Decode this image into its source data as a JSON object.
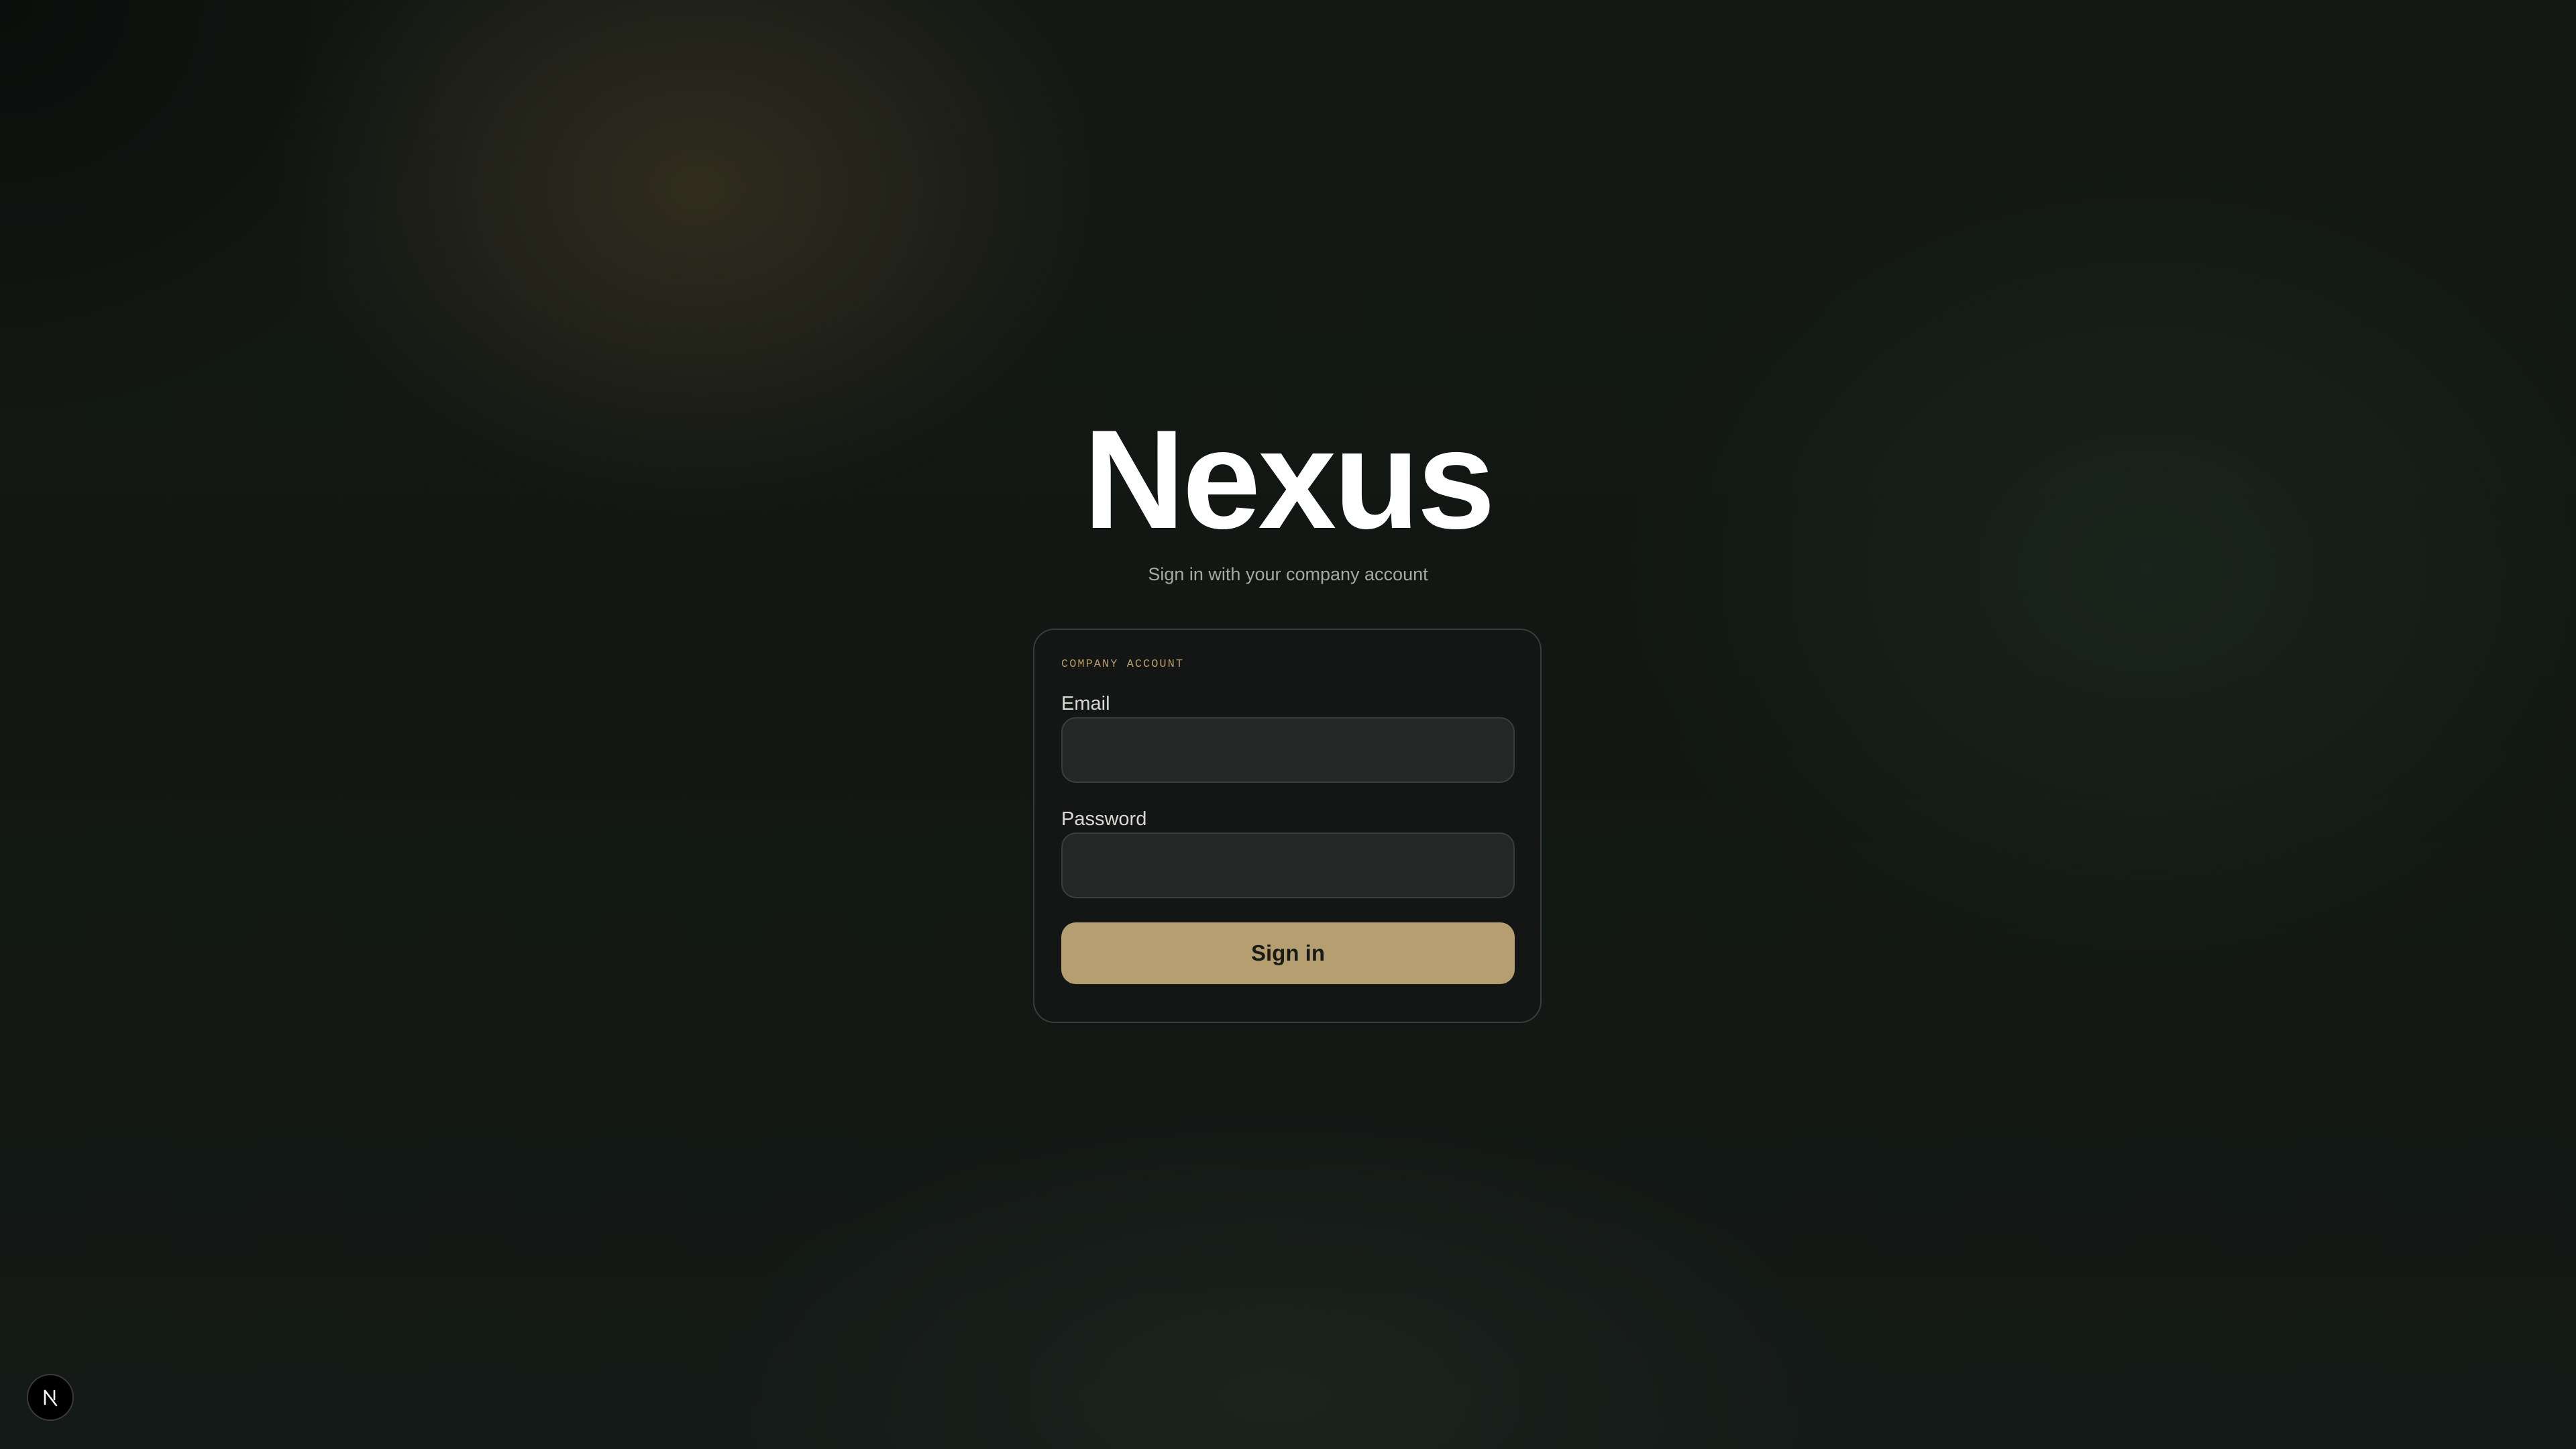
{
  "brand": {
    "title": "Nexus",
    "subtitle": "Sign in with your company account"
  },
  "login_card": {
    "eyebrow": "COMPANY ACCOUNT",
    "email_label": "Email",
    "email_value": "",
    "email_placeholder": "",
    "password_label": "Password",
    "password_value": "",
    "password_placeholder": "",
    "submit_label": "Sign in"
  },
  "corner_badge": {
    "icon": "n-logo-icon"
  },
  "colors": {
    "background": "#121713",
    "accent": "#b59f70",
    "eyebrow": "#b79b6a",
    "input_background": "#232725",
    "card_border": "#3a3d3a"
  }
}
